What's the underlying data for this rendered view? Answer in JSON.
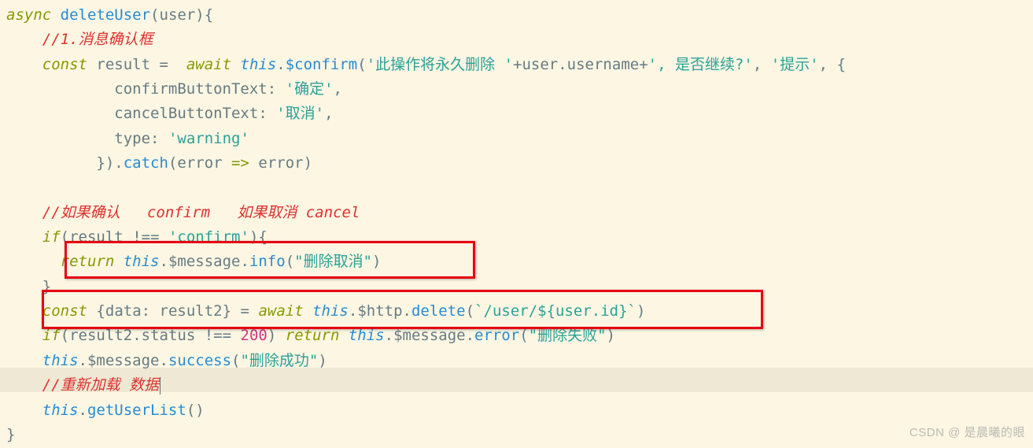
{
  "code": {
    "fn_sig_async": "async",
    "fn_name": "deleteUser",
    "fn_param": "user",
    "cm1": "//1.消息确认框",
    "const1": "const",
    "result": "result",
    "await1": "await",
    "this": "this",
    "confirm": "$confirm",
    "confirm_msg_a": "'此操作将永久删除 '",
    "plus": "+",
    "user_username": "user.username",
    "confirm_msg_b": "', 是否继续?'",
    "confirm_title": "'提示'",
    "conf_btn_key": "confirmButtonText",
    "conf_btn_val": "'确定'",
    "cancel_btn_key": "cancelButtonText",
    "cancel_btn_val": "'取消'",
    "type_key": "type",
    "type_val": "'warning'",
    "catch": "catch",
    "error": "error",
    "arrow": "=>",
    "cm2": "//如果确认   confirm   如果取消 cancel",
    "if": "if",
    "neq": "!==",
    "confirm_str": "'confirm'",
    "return": "return",
    "message": "$message",
    "info": "info",
    "info_arg": "\"删除取消\"",
    "const2": "const",
    "data": "data",
    "result2": "result2",
    "await2": "await",
    "http": "$http",
    "delete": "delete",
    "delete_arg": "`/user/${user.id}`",
    "status": "status",
    "n200": "200",
    "error_m": "error",
    "error_arg": "\"删除失败\"",
    "success": "success",
    "success_arg": "\"删除成功\"",
    "cm3": "//重新加载 数据",
    "getUserList": "getUserList"
  },
  "watermark": "CSDN @ 是晨曦的眼"
}
